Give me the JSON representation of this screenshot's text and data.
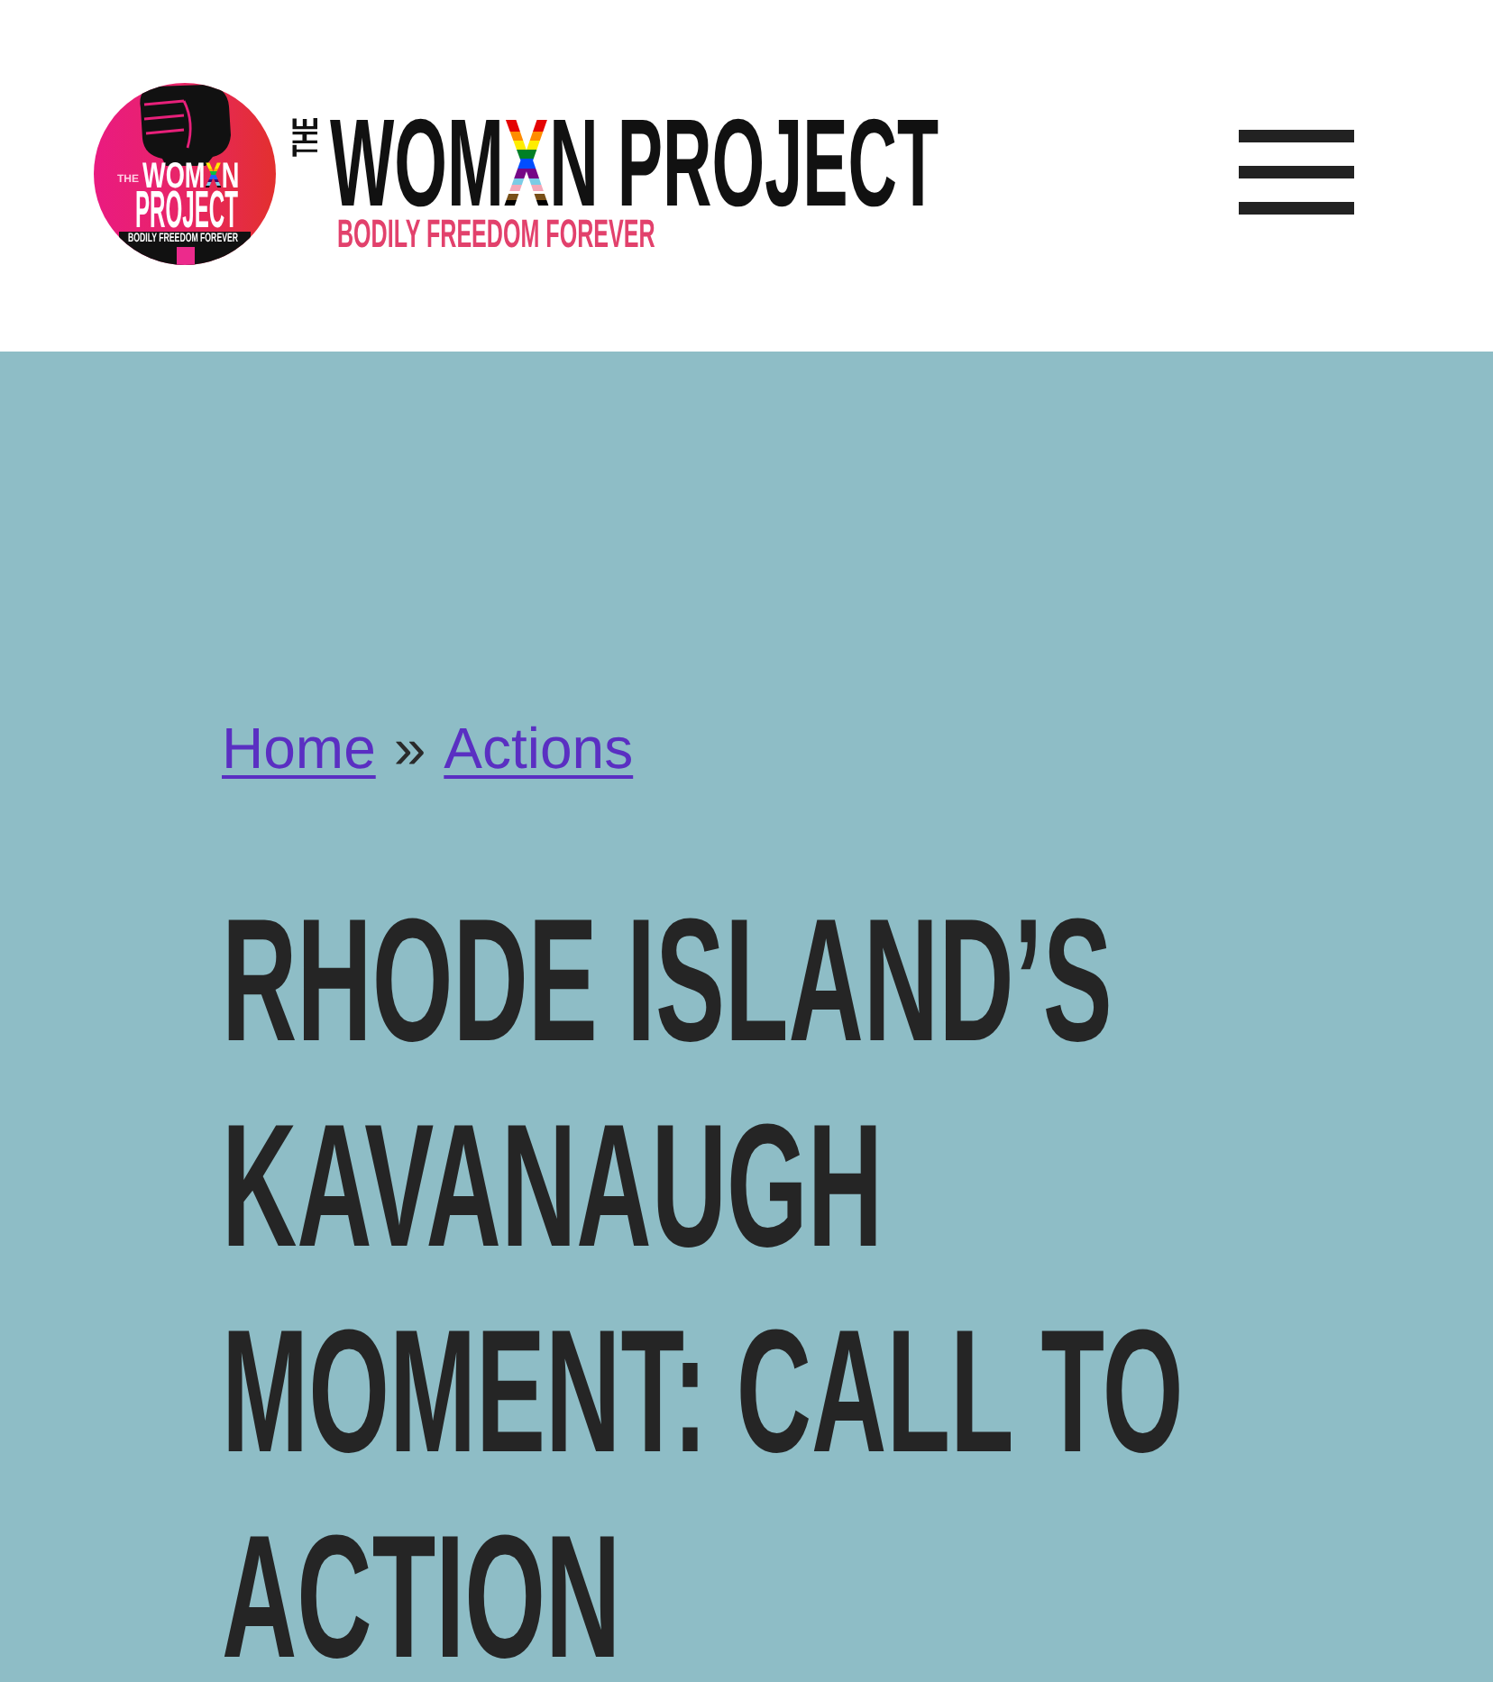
{
  "header": {
    "badge": {
      "small_word": "THE",
      "name_start": "WOM",
      "name_accent": "X",
      "name_end": "N",
      "second_line": "PROJECT",
      "tagline": "BODILY FREEDOM FOREVER"
    },
    "wordmark": {
      "small_word": "THE",
      "name_start": "WOM",
      "name_accent": "X",
      "name_end": "N PROJECT",
      "tagline": "BODILY FREEDOM FOREVER"
    }
  },
  "breadcrumb": {
    "items": [
      {
        "label": "Home"
      },
      {
        "label": "Actions"
      }
    ],
    "separator": "»"
  },
  "title": "RHODE ISLAND’S KAVANAUGH MOMENT: CALL TO ACTION"
}
